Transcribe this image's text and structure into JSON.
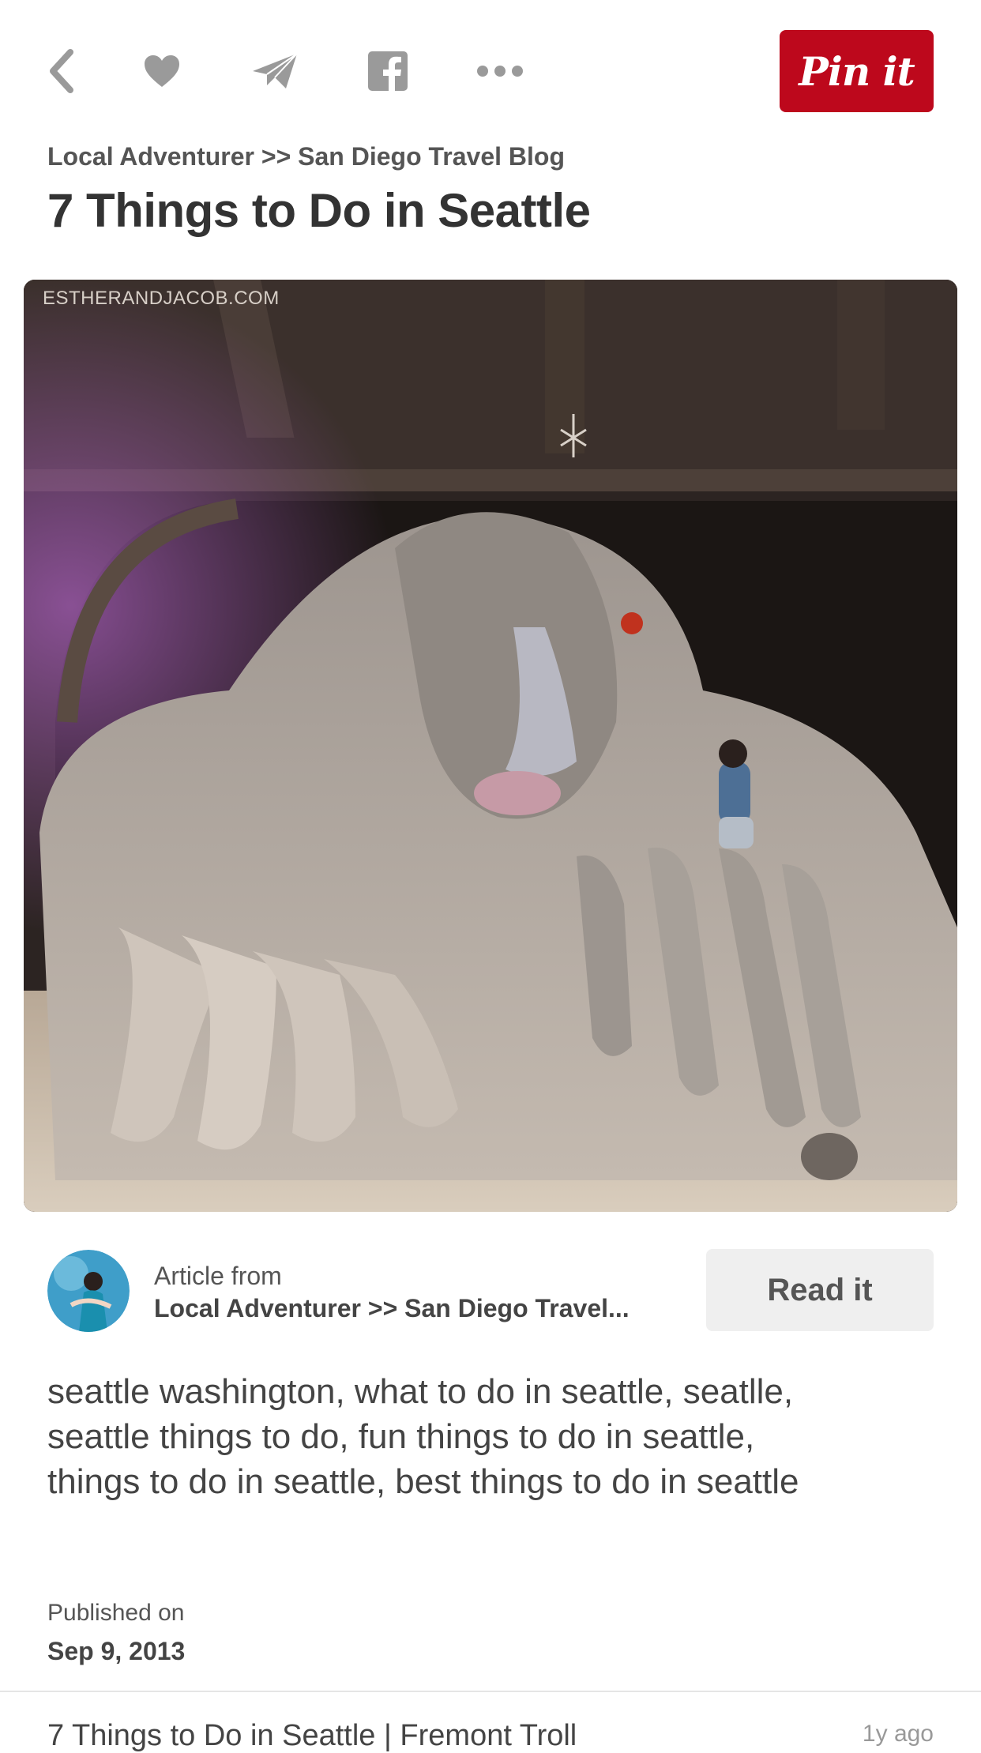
{
  "toolbar": {
    "icons": [
      "back-icon",
      "heart-icon",
      "send-icon",
      "facebook-icon",
      "more-icon"
    ],
    "pin_label": "Pin it",
    "icon_color": "#9a9a9a",
    "pin_color": "#bd081c"
  },
  "header": {
    "source": "Local Adventurer >> San Diego Travel Blog",
    "title": "7 Things to Do in Seattle"
  },
  "pin_image": {
    "watermark": "ESTHERANDJACOB.COM"
  },
  "article": {
    "label": "Article from",
    "source": "Local Adventurer >> San Diego Travel...",
    "read_label": "Read it"
  },
  "description": "seattle washington, what to do in seattle, seatlle, seattle things to do, fun things to do in seattle, things to do in seattle, best things to do in seattle",
  "published": {
    "label": "Published on",
    "date": "Sep 9, 2013"
  },
  "related": {
    "title": "7 Things to Do in Seattle | Fremont Troll",
    "time": "1y ago"
  }
}
